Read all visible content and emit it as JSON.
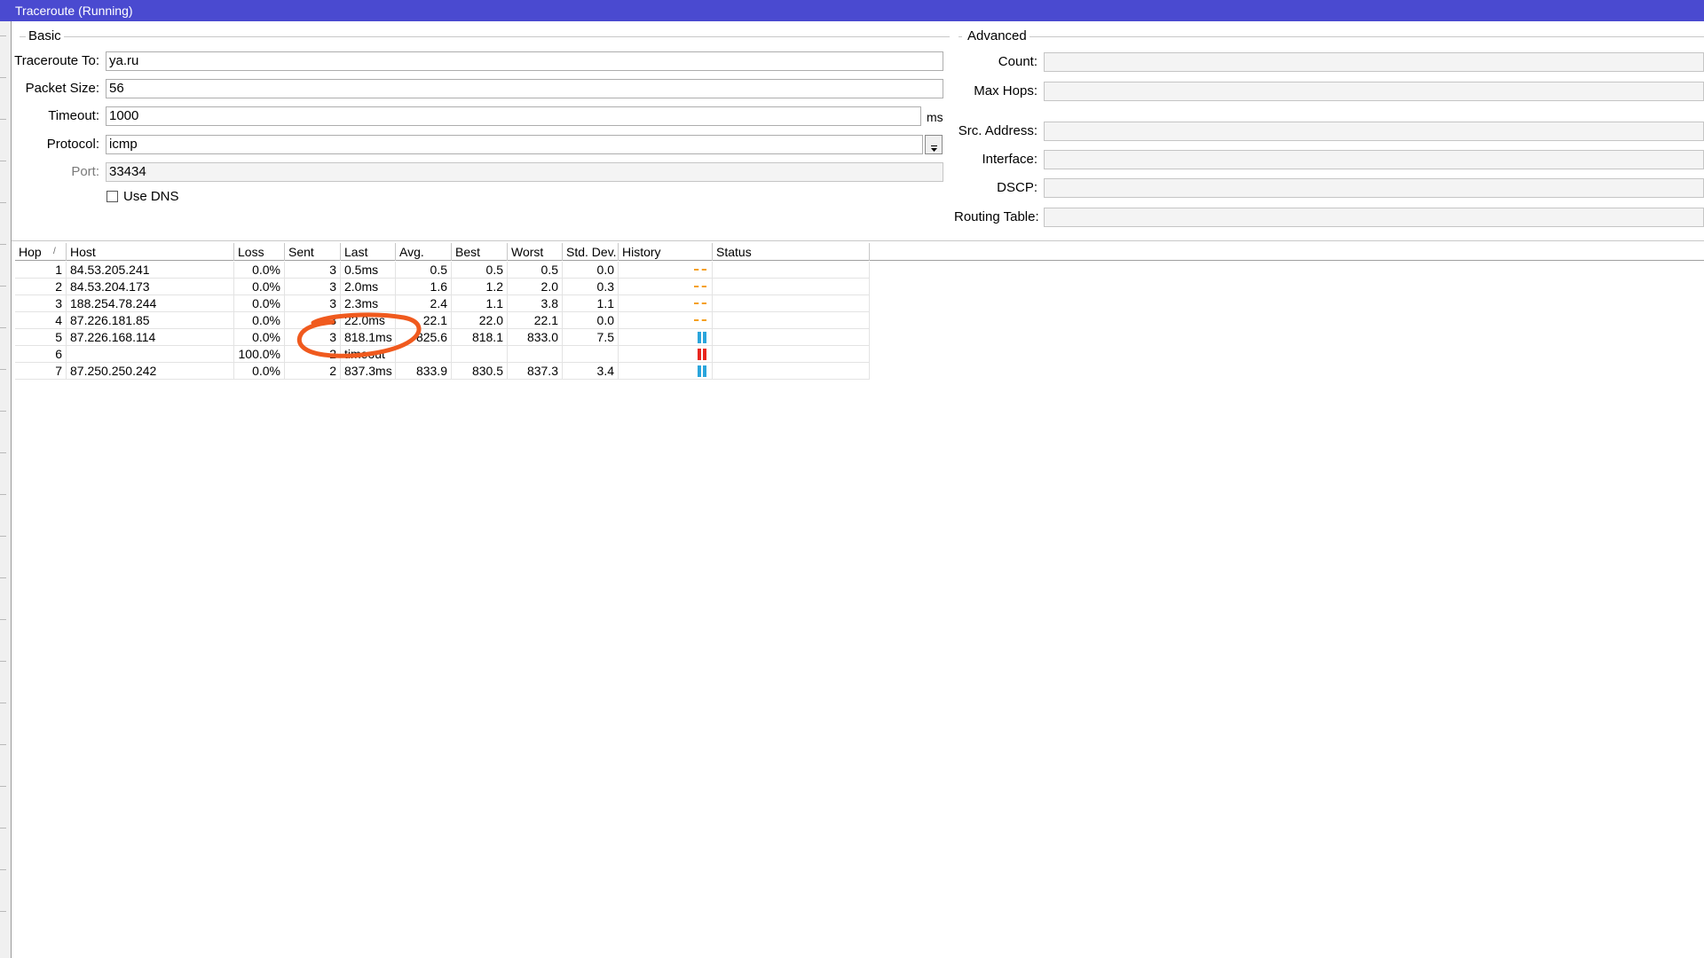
{
  "window": {
    "title": "Traceroute (Running)"
  },
  "basic": {
    "group_label": "Basic",
    "traceroute_to": {
      "label": "Traceroute To:",
      "value": "ya.ru"
    },
    "packet_size": {
      "label": "Packet Size:",
      "value": "56"
    },
    "timeout": {
      "label": "Timeout:",
      "value": "1000",
      "unit": "ms"
    },
    "protocol": {
      "label": "Protocol:",
      "value": "icmp"
    },
    "port": {
      "label": "Port:",
      "value": "33434"
    },
    "use_dns": {
      "label": "Use DNS",
      "checked": false
    }
  },
  "advanced": {
    "group_label": "Advanced",
    "count": {
      "label": "Count:",
      "value": ""
    },
    "max_hops": {
      "label": "Max Hops:",
      "value": ""
    },
    "src_address": {
      "label": "Src. Address:",
      "value": ""
    },
    "interface": {
      "label": "Interface:",
      "value": ""
    },
    "dscp": {
      "label": "DSCP:",
      "value": ""
    },
    "routing_table": {
      "label": "Routing Table:",
      "value": ""
    }
  },
  "table": {
    "columns": [
      "Hop",
      "Host",
      "Loss",
      "Sent",
      "Last",
      "Avg.",
      "Best",
      "Worst",
      "Std. Dev.",
      "History",
      "Status"
    ],
    "sort_indicator": "/",
    "rows": [
      {
        "hop": "1",
        "host": "84.53.205.241",
        "loss": "0.0%",
        "sent": "3",
        "last": "0.5ms",
        "avg": "0.5",
        "best": "0.5",
        "worst": "0.5",
        "std": "0.0",
        "history": "dashes"
      },
      {
        "hop": "2",
        "host": "84.53.204.173",
        "loss": "0.0%",
        "sent": "3",
        "last": "2.0ms",
        "avg": "1.6",
        "best": "1.2",
        "worst": "2.0",
        "std": "0.3",
        "history": "dashes"
      },
      {
        "hop": "3",
        "host": "188.254.78.244",
        "loss": "0.0%",
        "sent": "3",
        "last": "2.3ms",
        "avg": "2.4",
        "best": "1.1",
        "worst": "3.8",
        "std": "1.1",
        "history": "dashes"
      },
      {
        "hop": "4",
        "host": "87.226.181.85",
        "loss": "0.0%",
        "sent": "3",
        "last": "22.0ms",
        "avg": "22.1",
        "best": "22.0",
        "worst": "22.1",
        "std": "0.0",
        "history": "dashes"
      },
      {
        "hop": "5",
        "host": "87.226.168.114",
        "loss": "0.0%",
        "sent": "3",
        "last": "818.1ms",
        "avg": "825.6",
        "best": "818.1",
        "worst": "833.0",
        "std": "7.5",
        "history": "blue-bars"
      },
      {
        "hop": "6",
        "host": "",
        "loss": "100.0%",
        "sent": "2",
        "last": "timeout",
        "avg": "",
        "best": "",
        "worst": "",
        "std": "",
        "history": "red-bars"
      },
      {
        "hop": "7",
        "host": "87.250.250.242",
        "loss": "0.0%",
        "sent": "2",
        "last": "837.3ms",
        "avg": "833.9",
        "best": "830.5",
        "worst": "837.3",
        "std": "3.4",
        "history": "blue-bars"
      }
    ]
  },
  "colors": {
    "titlebar": "#4a4ad0",
    "history_ok": "#2aa5dc",
    "history_warn": "#f5a020",
    "history_timeout": "#e8261e",
    "annotation": "#f05a1e"
  },
  "icons": {
    "protocol_dropdown": "dropdown-arrow-icon"
  }
}
